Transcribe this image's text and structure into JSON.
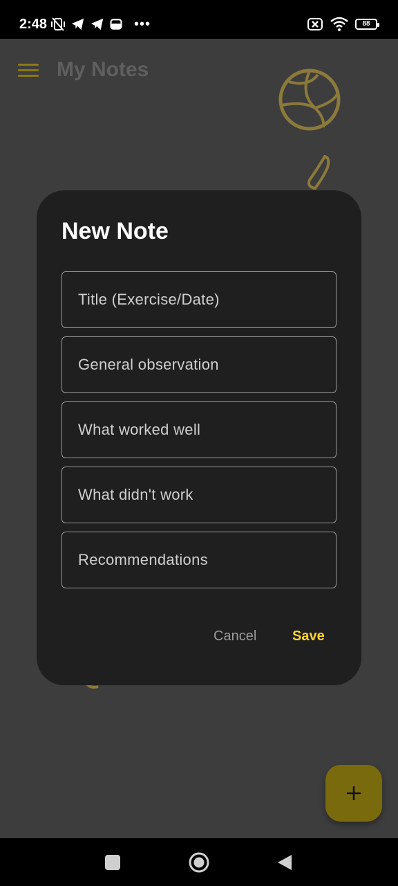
{
  "status_bar": {
    "time": "2:48",
    "battery": "88",
    "overflow": "•••",
    "icons": [
      "vibrate-off-icon",
      "telegram-icon",
      "telegram-icon",
      "storage-icon",
      "sim-off-icon",
      "wifi-icon",
      "battery-icon"
    ]
  },
  "app_bar": {
    "title": "My Notes",
    "menu_icon": "menu-icon"
  },
  "dialog": {
    "title": "New Note",
    "fields": [
      {
        "placeholder": "Title (Exercise/Date)"
      },
      {
        "placeholder": "General observation"
      },
      {
        "placeholder": "What worked well"
      },
      {
        "placeholder": "What didn't work"
      },
      {
        "placeholder": "Recommendations"
      }
    ],
    "cancel_label": "Cancel",
    "save_label": "Save"
  },
  "fab": {
    "icon": "plus-icon"
  },
  "nav_bar": {
    "icons": [
      "recents-icon",
      "home-icon",
      "back-icon"
    ]
  },
  "colors": {
    "accent": "#ffd233",
    "fab": "#7a6a0e",
    "dialog_bg": "#1f1f1f",
    "scrim_bg": "#3d3d3d"
  }
}
